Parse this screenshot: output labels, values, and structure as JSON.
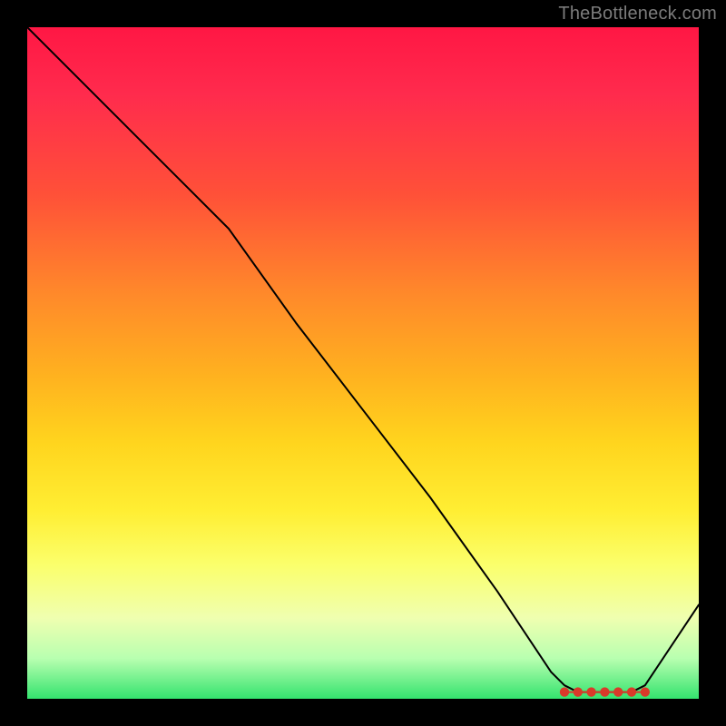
{
  "attribution": "TheBottleneck.com",
  "chart_data": {
    "type": "line",
    "title": "",
    "xlabel": "",
    "ylabel": "",
    "xlim": [
      0,
      100
    ],
    "ylim": [
      0,
      100
    ],
    "grid": false,
    "legend": false,
    "series": [
      {
        "name": "curve",
        "x": [
          0,
          8,
          16,
          24,
          30,
          40,
          50,
          60,
          70,
          78,
          80,
          82,
          84,
          86,
          88,
          90,
          92,
          100
        ],
        "y": [
          100,
          92,
          84,
          76,
          70,
          56,
          43,
          30,
          16,
          4,
          2,
          1,
          1,
          1,
          1,
          1,
          2,
          14
        ]
      }
    ],
    "markers": {
      "name": "band",
      "x": [
        80,
        82,
        84,
        86,
        88,
        90,
        92
      ],
      "y": [
        1,
        1,
        1,
        1,
        1,
        1,
        1
      ],
      "color": "#d93a2a"
    }
  }
}
